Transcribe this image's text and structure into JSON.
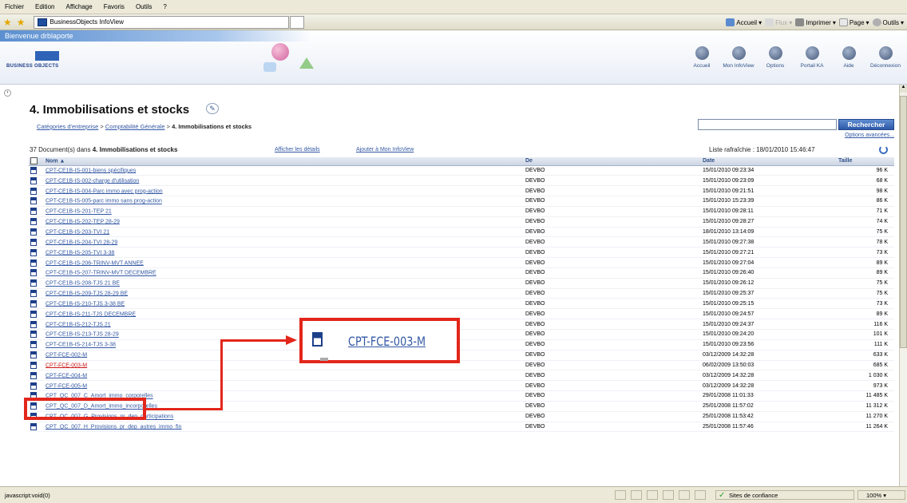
{
  "menu": [
    "Fichier",
    "Edition",
    "Affichage",
    "Favoris",
    "Outils",
    "?"
  ],
  "browser_tab_title": "BusinessObjects InfoView",
  "browser_toolbar": {
    "home": "Accueil",
    "feeds": "Flux",
    "print": "Imprimer",
    "page": "Page",
    "tools": "Outils"
  },
  "app": {
    "welcome": "Bienvenue drblaporte",
    "logo_text": "BUSINESS OBJECTS",
    "nav": [
      {
        "label": "Accueil",
        "icon": "home-icon"
      },
      {
        "label": "Mon InfoView",
        "icon": "infoview-icon"
      },
      {
        "label": "Options",
        "icon": "options-icon"
      },
      {
        "label": "Portail KA",
        "icon": "portal-icon"
      },
      {
        "label": "Aide",
        "icon": "help-icon"
      },
      {
        "label": "Déconnexion",
        "icon": "logout-icon"
      }
    ]
  },
  "page": {
    "title": "4. Immobilisations et stocks",
    "breadcrumb": [
      {
        "label": "Catégories d'entreprise",
        "link": true
      },
      {
        "label": "Comptabilité Générale",
        "link": true
      },
      {
        "label": "4. Immobilisations et stocks",
        "link": false
      }
    ],
    "search_button": "Rechercher",
    "advanced_options": "Options avancées...",
    "doc_count_prefix": "37 Document(s) dans",
    "doc_count_folder": "4. Immobilisations et stocks",
    "details_link": "Afficher les détails",
    "add_link": "Ajouter à Mon InfoView",
    "refresh_label": "Liste rafraîchie : 18/01/2010 15:46:47"
  },
  "table": {
    "headers": [
      "Nom ▲",
      "De",
      "Date",
      "Taille"
    ],
    "rows": [
      [
        "CPT-CE1B-IS-001-biens spécifiques",
        "DEVBO",
        "15/01/2010 09:23:34",
        "96 K"
      ],
      [
        "CPT-CE1B-IS-002-charge d'utilisation",
        "DEVBO",
        "15/01/2010 09:23:09",
        "68 K"
      ],
      [
        "CPT-CE1B-IS-004-Parc immo avec prog-action",
        "DEVBO",
        "15/01/2010 09:21:51",
        "98 K"
      ],
      [
        "CPT-CE1B-IS-005-parc immo sans prog-action",
        "DEVBO",
        "15/01/2010 15:23:39",
        "86 K"
      ],
      [
        "CPT-CE1B-IS-201-TEP 21",
        "DEVBO",
        "15/01/2010 09:28:11",
        "71 K"
      ],
      [
        "CPT-CE1B-IS-202-TEP 28-29",
        "DEVBO",
        "15/01/2010 09:28:27",
        "74 K"
      ],
      [
        "CPT-CE1B-IS-203-TVI 21",
        "DEVBO",
        "18/01/2010 13:14:09",
        "75 K"
      ],
      [
        "CPT-CE1B-IS-204-TVI 28-29",
        "DEVBO",
        "15/01/2010 09:27:38",
        "78 K"
      ],
      [
        "CPT-CE1B-IS-205-TVI 3-38",
        "DEVBO",
        "15/01/2010 09:27:21",
        "73 K"
      ],
      [
        "CPT-CE1B-IS-206-TRINV-MVT ANNEE",
        "DEVBO",
        "15/01/2010 09:27:04",
        "89 K"
      ],
      [
        "CPT-CE1B-IS-207-TRINV-MVT DECEMBRE",
        "DEVBO",
        "15/01/2010 09:26:40",
        "89 K"
      ],
      [
        "CPT-CE1B-IS-208-TJS 21 BE",
        "DEVBO",
        "15/01/2010 09:26:12",
        "75 K"
      ],
      [
        "CPT-CE1B-IS-209-TJS 28-29 BE",
        "DEVBO",
        "15/01/2010 09:25:37",
        "75 K"
      ],
      [
        "CPT-CE1B-IS-210-TJS 3-38 BE",
        "DEVBO",
        "15/01/2010 09:25:15",
        "73 K"
      ],
      [
        "CPT-CE1B-IS-211-TJS DECEMBRE",
        "DEVBO",
        "15/01/2010 09:24:57",
        "89 K"
      ],
      [
        "CPT-CE1B-IS-212-TJS 21",
        "DEVBO",
        "15/01/2010 09:24:37",
        "116 K"
      ],
      [
        "CPT-CE1B-IS-213-TJS 28-29",
        "DEVBO",
        "15/01/2010 09:24:20",
        "101 K"
      ],
      [
        "CPT-CE1B-IS-214-TJS 3-38",
        "DEVBO",
        "15/01/2010 09:23:56",
        "111 K"
      ],
      [
        "CPT-FCE-002-M",
        "DEVBO",
        "03/12/2009 14:32:28",
        "633 K"
      ],
      [
        "CPT-FCE-003-M",
        "DEVBO",
        "06/02/2009 13:50:03",
        "685 K"
      ],
      [
        "CPT-FCE-004-M",
        "DEVBO",
        "03/12/2009 14:32:28",
        "1 030 K"
      ],
      [
        "CPT-FCE-005-M",
        "DEVBO",
        "03/12/2009 14:32:28",
        "973 K"
      ],
      [
        "CPT_QC_007_C_Amort_immo_corporelles",
        "DEVBO",
        "29/01/2008 11:01:33",
        "11 485 K"
      ],
      [
        "CPT_QC_007_D_Amort_immo_incorporelles",
        "DEVBO",
        "25/01/2008 11:57:02",
        "11 312 K"
      ],
      [
        "CPT_QC_007_G_Provisions_pr_dep_participations",
        "DEVBO",
        "25/01/2008 11:53:42",
        "11 270 K"
      ],
      [
        "CPT_QC_007_H_Provisions_pr_dep_autres_immo_fin",
        "DEVBO",
        "25/01/2008 11:57:46",
        "11 264 K"
      ]
    ],
    "highlighted_row": 19
  },
  "annotation": {
    "zoom_label": "CPT-FCE-003-M",
    "color": "#e3261b"
  },
  "status": {
    "text": "javascript:void(0)",
    "trust_zone": "Sites de confiance",
    "zoom": "100%"
  }
}
